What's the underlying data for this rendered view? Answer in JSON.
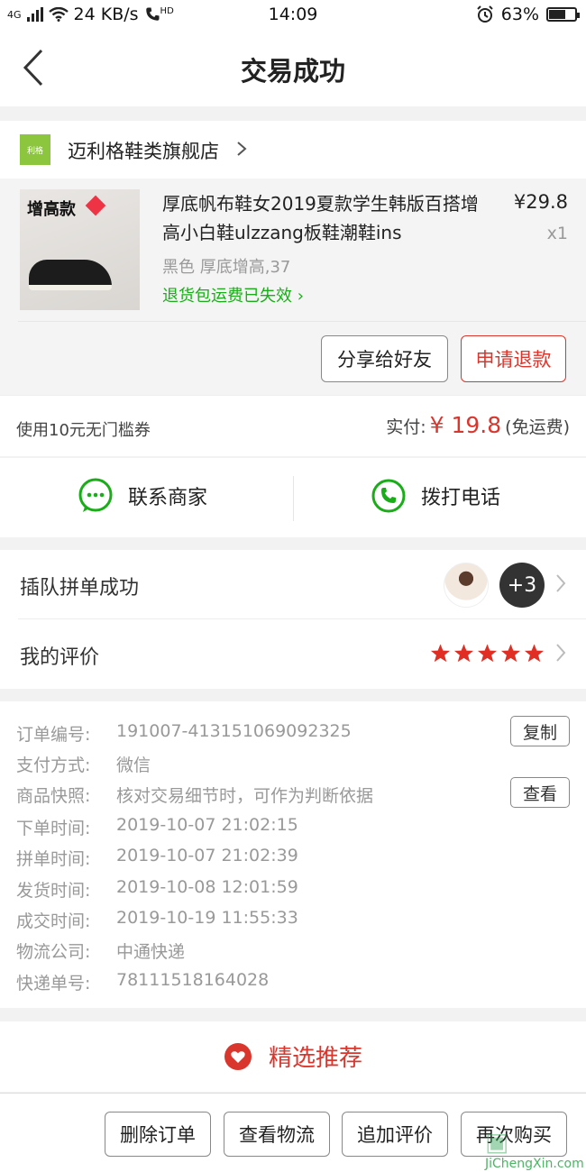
{
  "status_bar": {
    "network": "4G",
    "speed": "24 KB/s",
    "hd": "HD",
    "time": "14:09",
    "battery_pct": "63%",
    "battery_level": 0.63
  },
  "nav": {
    "title": "交易成功"
  },
  "shop": {
    "logo_text": "利格",
    "name": "迈利格鞋类旗舰店"
  },
  "product": {
    "thumb_tag": "增高款",
    "name": "厚底帆布鞋女2019夏款学生韩版百搭增高小白鞋ulzzang板鞋潮鞋ins",
    "price": "¥29.8",
    "qty": "x1",
    "spec": "黑色 厚底增高,37",
    "refund_info": "退货包运费已失效",
    "share_label": "分享给好友",
    "refund_label": "申请退款"
  },
  "payment": {
    "coupon": "使用10元无门槛券",
    "paid_label": "实付:",
    "amount": "¥ 19.8",
    "shipping": "(免运费)"
  },
  "contact": {
    "merchant_label": "联系商家",
    "phone_label": "拨打电话"
  },
  "group": {
    "label": "插队拼单成功",
    "extra_count": "+3"
  },
  "review": {
    "label": "我的评价",
    "stars": 5
  },
  "order_info": {
    "rows": [
      {
        "key": "订单编号:",
        "value": "191007-413151069092325",
        "action": "复制"
      },
      {
        "key": "支付方式:",
        "value": "微信"
      },
      {
        "key": "商品快照:",
        "value": "核对交易细节时，可作为判断依据",
        "action": "查看"
      },
      {
        "key": "下单时间:",
        "value": "2019-10-07 21:02:15"
      },
      {
        "key": "拼单时间:",
        "value": "2019-10-07 21:02:39"
      },
      {
        "key": "发货时间:",
        "value": "2019-10-08 12:01:59"
      },
      {
        "key": "成交时间:",
        "value": "2019-10-19 11:55:33"
      },
      {
        "key": "物流公司:",
        "value": "中通快递"
      },
      {
        "key": "快递单号:",
        "value": "78111518164028"
      }
    ]
  },
  "recommend": {
    "label": "精选推荐"
  },
  "bottom_bar": {
    "delete": "删除订单",
    "logistics": "查看物流",
    "add_review": "追加评价",
    "buy_again": "再次购买"
  },
  "watermark": {
    "brand": "JiChengXin.com"
  },
  "colors": {
    "accent_red": "#d9362d",
    "green": "#1aad19",
    "star": "#e02e24"
  }
}
